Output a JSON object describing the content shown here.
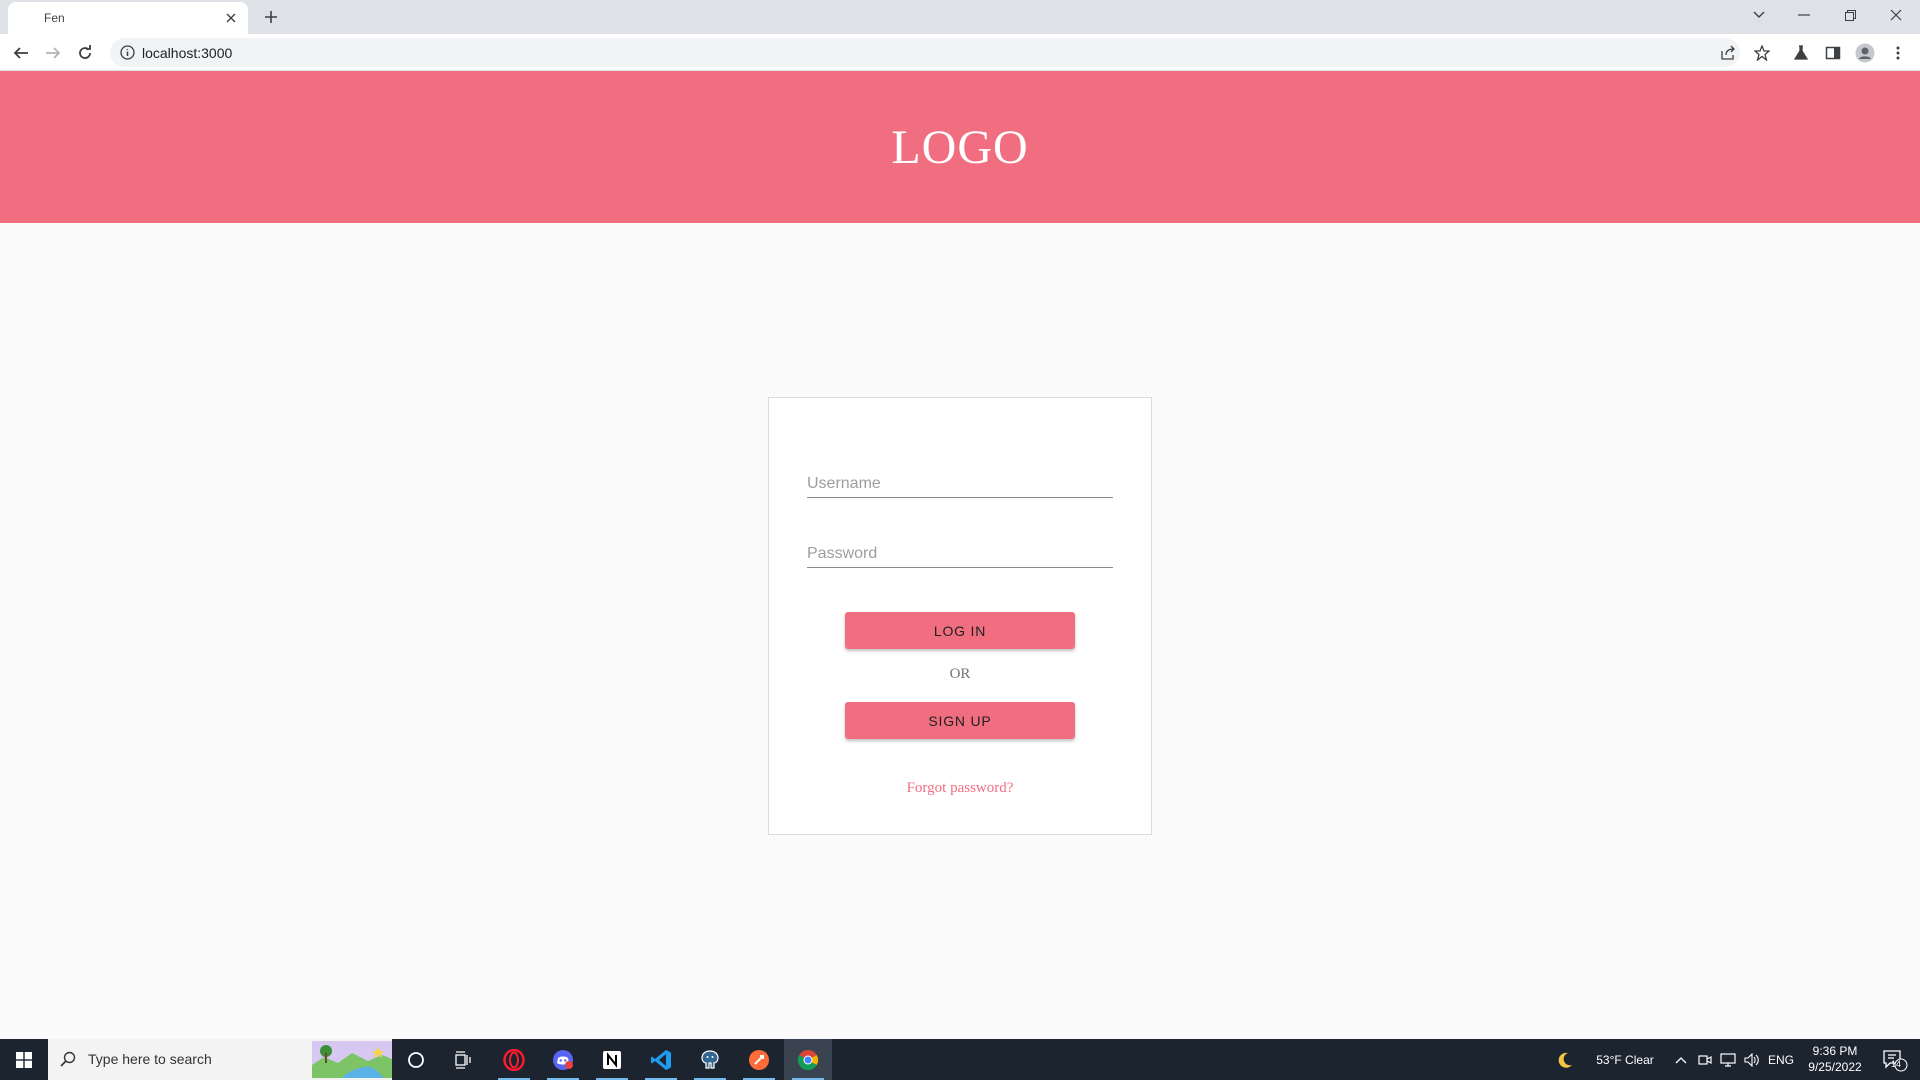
{
  "browser": {
    "tab_title": "Fen",
    "url": "localhost:3000"
  },
  "header": {
    "logo_text": "LOGO",
    "background_color": "#f06e80"
  },
  "login": {
    "username_placeholder": "Username",
    "password_placeholder": "Password",
    "login_label": "LOG IN",
    "or_label": "OR",
    "signup_label": "SIGN UP",
    "forgot_label": "Forgot password?",
    "accent_color": "#f06e80"
  },
  "taskbar": {
    "search_placeholder": "Type here to search",
    "weather": "53°F  Clear",
    "language": "ENG",
    "time": "9:36 PM",
    "date": "9/25/2022",
    "notifications": "14"
  }
}
